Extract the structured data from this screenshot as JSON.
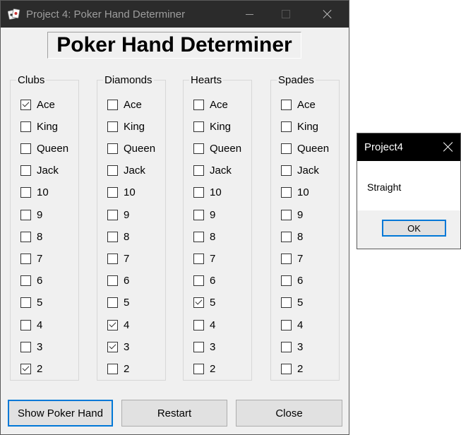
{
  "window": {
    "title": "Project 4: Poker Hand Determiner",
    "heading": "Poker Hand Determiner"
  },
  "suits": [
    {
      "name": "Clubs",
      "cards": [
        {
          "label": "Ace",
          "checked": true
        },
        {
          "label": "King",
          "checked": false
        },
        {
          "label": "Queen",
          "checked": false
        },
        {
          "label": "Jack",
          "checked": false
        },
        {
          "label": "10",
          "checked": false
        },
        {
          "label": "9",
          "checked": false
        },
        {
          "label": "8",
          "checked": false
        },
        {
          "label": "7",
          "checked": false
        },
        {
          "label": "6",
          "checked": false
        },
        {
          "label": "5",
          "checked": false
        },
        {
          "label": "4",
          "checked": false
        },
        {
          "label": "3",
          "checked": false
        },
        {
          "label": "2",
          "checked": true
        }
      ]
    },
    {
      "name": "Diamonds",
      "cards": [
        {
          "label": "Ace",
          "checked": false
        },
        {
          "label": "King",
          "checked": false
        },
        {
          "label": "Queen",
          "checked": false
        },
        {
          "label": "Jack",
          "checked": false
        },
        {
          "label": "10",
          "checked": false
        },
        {
          "label": "9",
          "checked": false
        },
        {
          "label": "8",
          "checked": false
        },
        {
          "label": "7",
          "checked": false
        },
        {
          "label": "6",
          "checked": false
        },
        {
          "label": "5",
          "checked": false
        },
        {
          "label": "4",
          "checked": true
        },
        {
          "label": "3",
          "checked": true
        },
        {
          "label": "2",
          "checked": false
        }
      ]
    },
    {
      "name": "Hearts",
      "cards": [
        {
          "label": "Ace",
          "checked": false
        },
        {
          "label": "King",
          "checked": false
        },
        {
          "label": "Queen",
          "checked": false
        },
        {
          "label": "Jack",
          "checked": false
        },
        {
          "label": "10",
          "checked": false
        },
        {
          "label": "9",
          "checked": false
        },
        {
          "label": "8",
          "checked": false
        },
        {
          "label": "7",
          "checked": false
        },
        {
          "label": "6",
          "checked": false
        },
        {
          "label": "5",
          "checked": true
        },
        {
          "label": "4",
          "checked": false
        },
        {
          "label": "3",
          "checked": false
        },
        {
          "label": "2",
          "checked": false
        }
      ]
    },
    {
      "name": "Spades",
      "cards": [
        {
          "label": "Ace",
          "checked": false
        },
        {
          "label": "King",
          "checked": false
        },
        {
          "label": "Queen",
          "checked": false
        },
        {
          "label": "Jack",
          "checked": false
        },
        {
          "label": "10",
          "checked": false
        },
        {
          "label": "9",
          "checked": false
        },
        {
          "label": "8",
          "checked": false
        },
        {
          "label": "7",
          "checked": false
        },
        {
          "label": "6",
          "checked": false
        },
        {
          "label": "5",
          "checked": false
        },
        {
          "label": "4",
          "checked": false
        },
        {
          "label": "3",
          "checked": false
        },
        {
          "label": "2",
          "checked": false
        }
      ]
    }
  ],
  "buttons": {
    "show": "Show Poker Hand",
    "restart": "Restart",
    "close": "Close"
  },
  "dialog": {
    "title": "Project4",
    "message": "Straight",
    "ok": "OK"
  },
  "colors": {
    "titlebar": "#2b2b2b",
    "window_bg": "#f0f0f0",
    "accent": "#0078d7"
  }
}
